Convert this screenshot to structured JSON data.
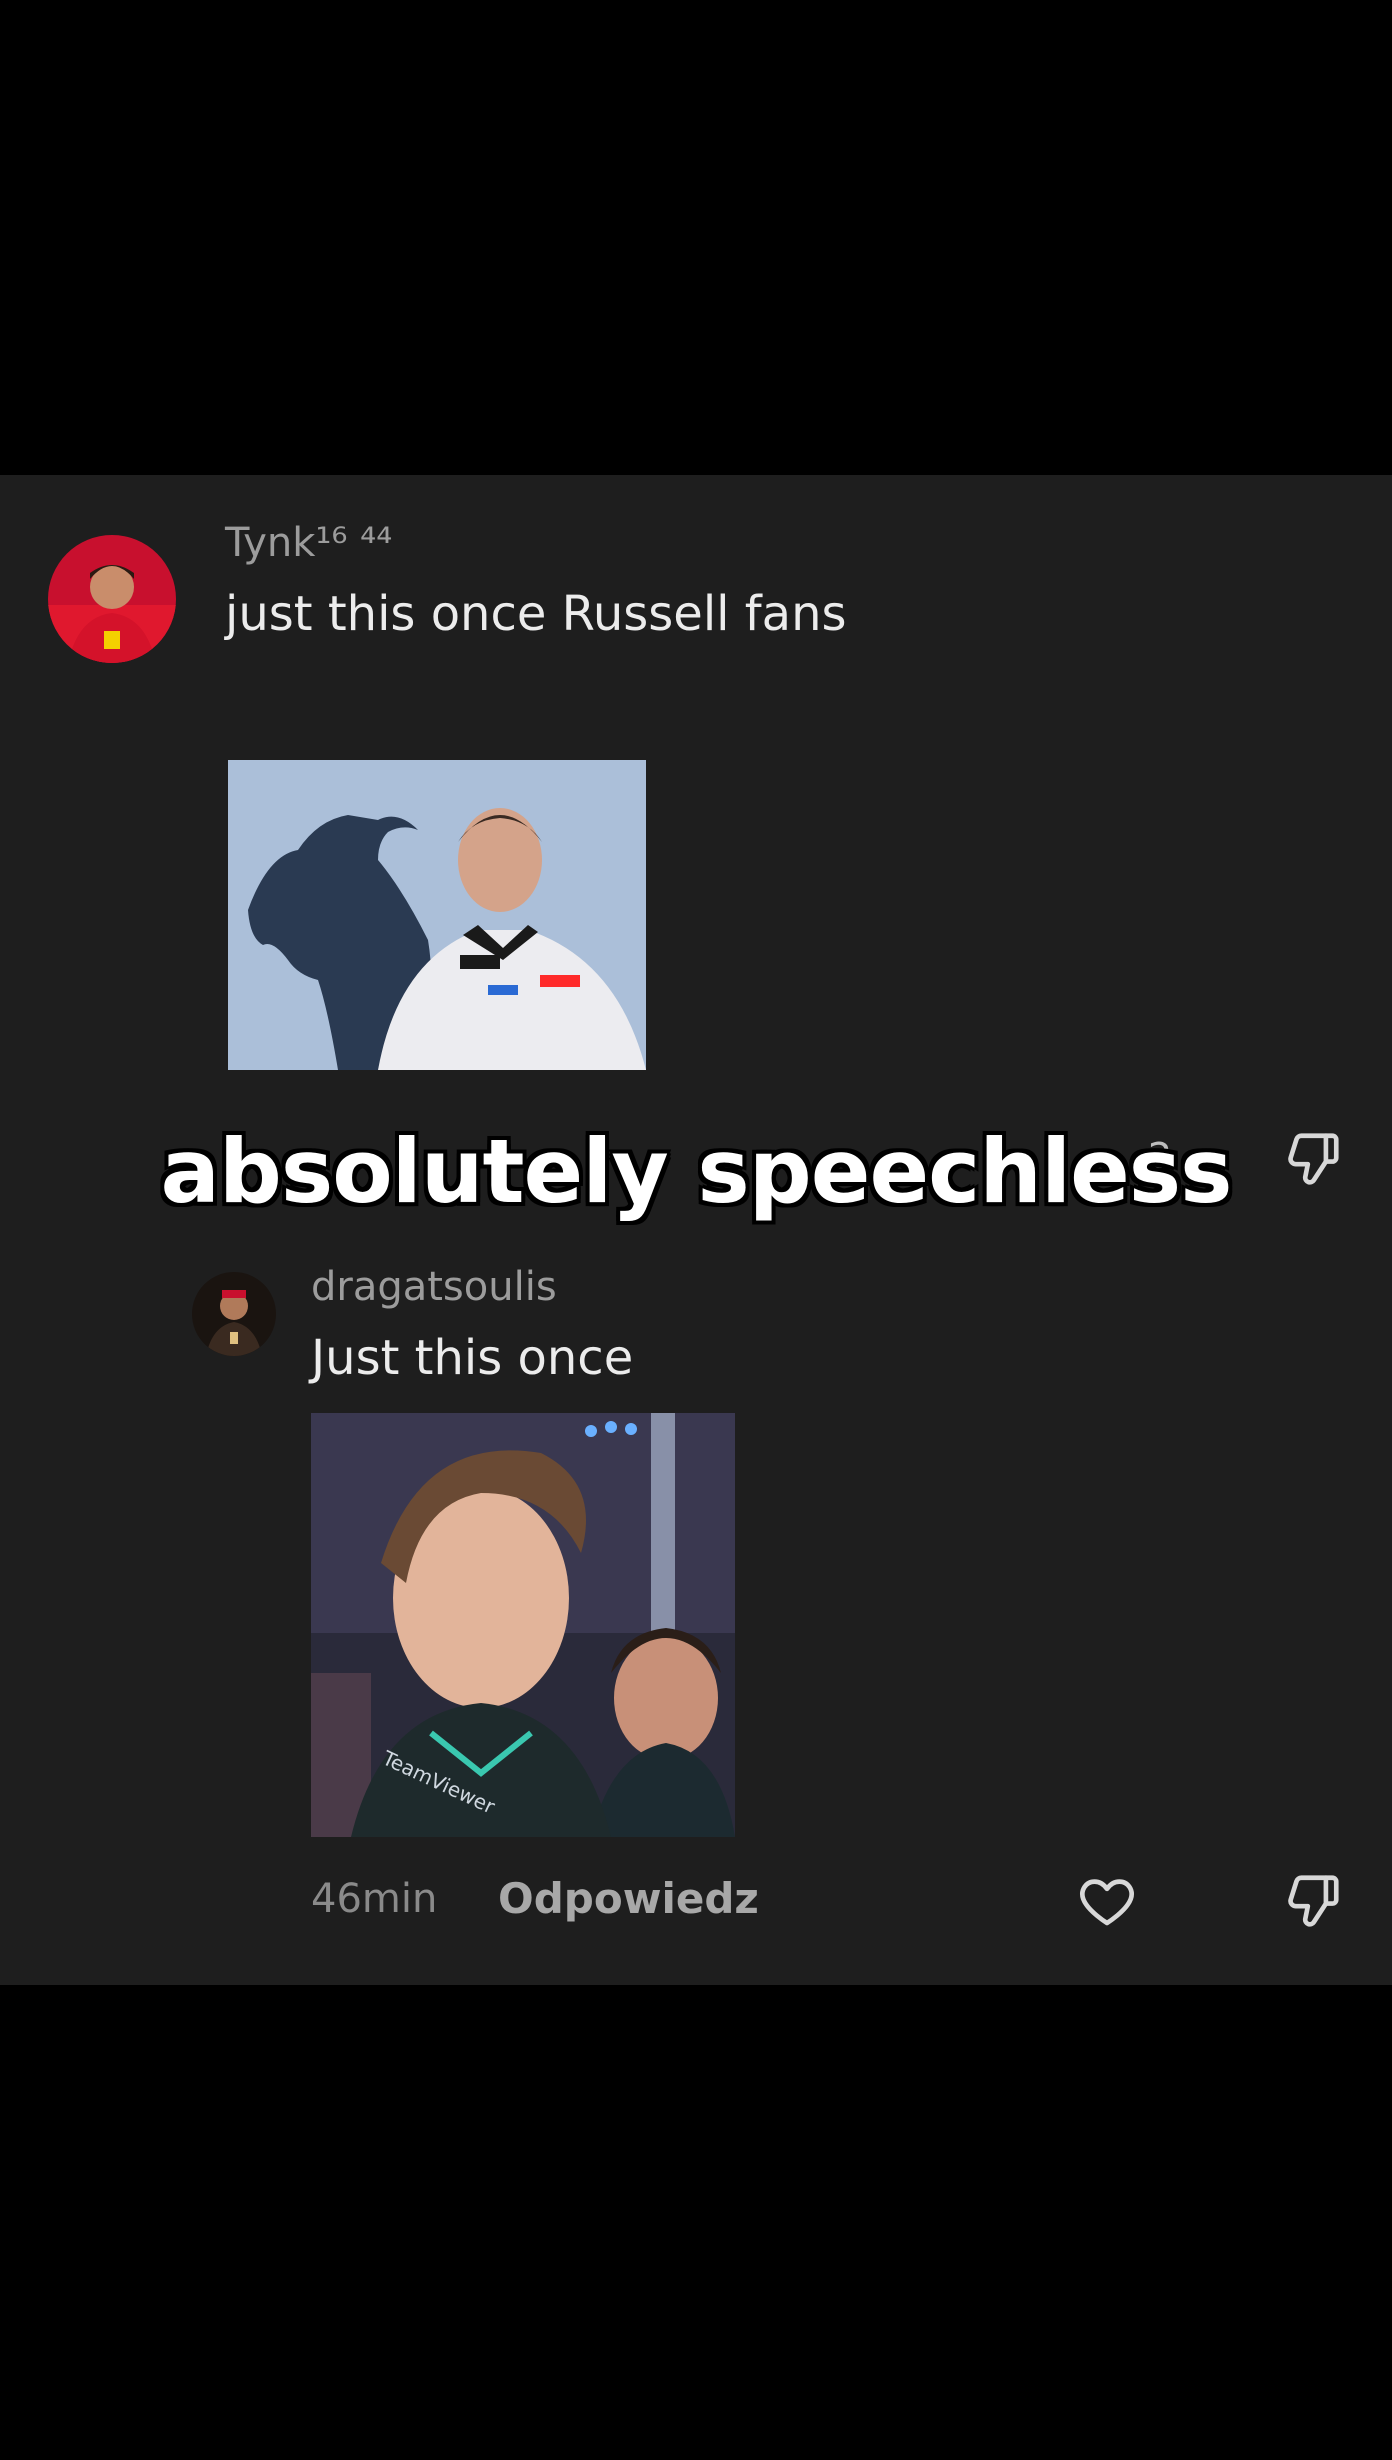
{
  "comments": [
    {
      "username": "Tynk¹⁶ ⁴⁴",
      "text": "just this once Russell fans",
      "like_count": "2"
    },
    {
      "username": "dragatsoulis",
      "text": "Just this once",
      "time": "46min",
      "reply_label": "Odpowiedz"
    }
  ],
  "overlay_caption": "absolutely speechless",
  "colors": {
    "panel_bg": "#1e1e1e",
    "outer_bg": "#000000",
    "username": "#9c9c9c",
    "comment_text": "#ececec"
  },
  "icons": [
    "heart-icon",
    "thumbs-down-icon"
  ]
}
